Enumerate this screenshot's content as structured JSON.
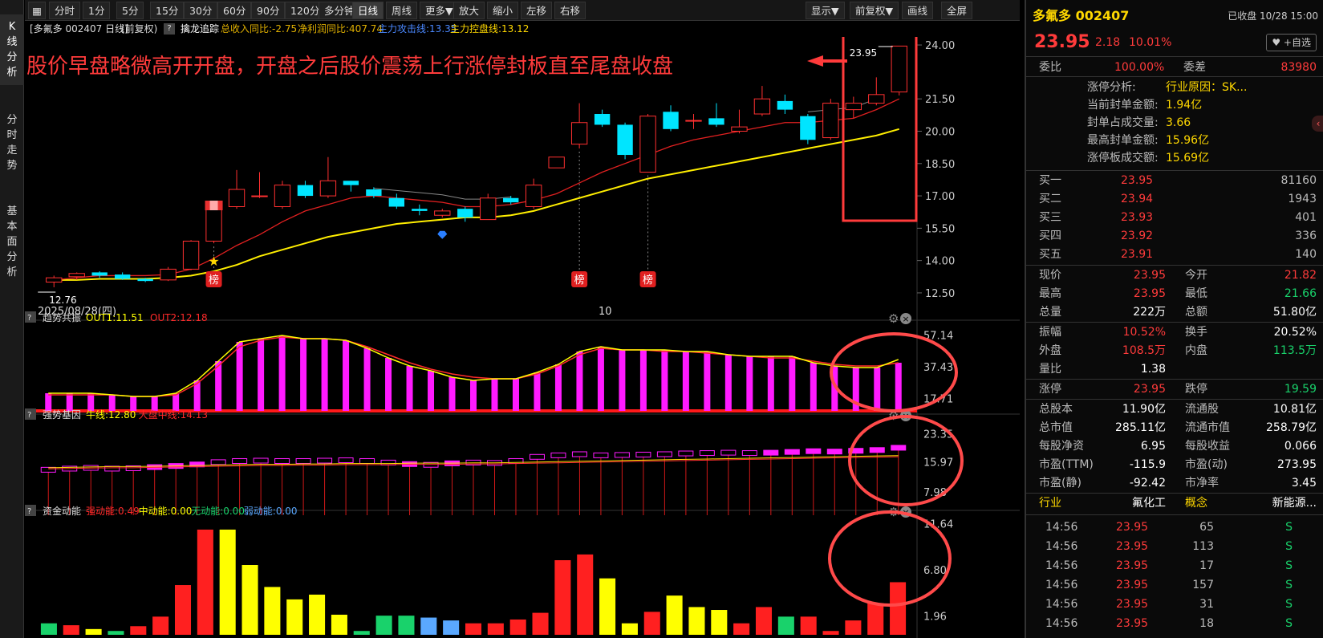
{
  "left_tabs": [
    {
      "label": "K线分析",
      "chars": [
        "K",
        "线",
        "分",
        "析"
      ],
      "active": true
    },
    {
      "label": "分时走势",
      "chars": [
        "分",
        "时",
        "走",
        "势"
      ],
      "active": false
    },
    {
      "label": "基本面分析",
      "chars": [
        "基",
        "本",
        "面",
        "分",
        "析"
      ],
      "active": false
    }
  ],
  "toolbar": {
    "grid_icon": "grid-icon",
    "buttons": [
      "分时",
      "1分",
      "5分",
      "15分",
      "30分",
      "60分",
      "90分",
      "120分",
      "多分钟",
      "日线",
      "周线",
      "更多▼",
      "放大",
      "缩小",
      "左移",
      "右移"
    ],
    "active": "日线",
    "right_buttons": [
      "显示▼",
      "前复权▼",
      "画线",
      "全屏"
    ]
  },
  "info_line": {
    "name": "[多氟多 002407 日线]",
    "adjust": "(前复权)",
    "indicator": "擒龙追踪",
    "revenue": "总收入同比:-2.75",
    "profit": "净利润同比:407.74",
    "attack": "主力攻击线:13.35",
    "control": "主力控盘线:13.12"
  },
  "annotation": {
    "text": "股价早盘略微高开开盘，开盘之后股价震荡上行涨停封板直至尾盘收盘",
    "color": "#ff3b3b"
  },
  "main_chart": {
    "y_ticks": [
      "24.00",
      "21.50",
      "20.00",
      "18.50",
      "17.00",
      "15.50",
      "14.00",
      "12.50"
    ],
    "low_label": "12.76",
    "high_label": "23.95",
    "date_label": "2025/08/28(四)",
    "mid_date": "10",
    "badge": "榜"
  },
  "chart_data": [
    {
      "type": "candlestick",
      "title": "日线",
      "y_range": [
        12.2,
        24.3
      ],
      "y_ticks": [
        24.0,
        21.5,
        20.0,
        18.5,
        17.0,
        15.5,
        14.0,
        12.5
      ],
      "candles": [
        {
          "o": 13.0,
          "c": 13.2,
          "h": 13.3,
          "l": 12.76
        },
        {
          "o": 13.25,
          "c": 13.4,
          "h": 13.45,
          "l": 13.1
        },
        {
          "o": 13.45,
          "c": 13.3,
          "h": 13.5,
          "l": 13.2
        },
        {
          "o": 13.35,
          "c": 13.15,
          "h": 13.45,
          "l": 13.1
        },
        {
          "o": 13.15,
          "c": 13.05,
          "h": 13.2,
          "l": 13.0
        },
        {
          "o": 13.1,
          "c": 13.6,
          "h": 13.7,
          "l": 13.05
        },
        {
          "o": 13.6,
          "c": 14.9,
          "h": 14.95,
          "l": 13.55
        },
        {
          "o": 14.9,
          "c": 16.4,
          "h": 16.45,
          "l": 14.8
        },
        {
          "o": 16.5,
          "c": 17.3,
          "h": 18.2,
          "l": 16.4
        },
        {
          "o": 17.0,
          "c": 17.0,
          "h": 18.1,
          "l": 16.9
        },
        {
          "o": 16.5,
          "c": 17.5,
          "h": 17.7,
          "l": 16.4
        },
        {
          "o": 17.5,
          "c": 17.0,
          "h": 17.7,
          "l": 16.9
        },
        {
          "o": 17.0,
          "c": 17.7,
          "h": 18.8,
          "l": 16.9
        },
        {
          "o": 17.7,
          "c": 17.5,
          "h": 17.7,
          "l": 17.2
        },
        {
          "o": 17.3,
          "c": 17.0,
          "h": 17.4,
          "l": 16.9
        },
        {
          "o": 16.9,
          "c": 16.5,
          "h": 17.1,
          "l": 16.4
        },
        {
          "o": 16.4,
          "c": 16.3,
          "h": 16.6,
          "l": 16.1
        },
        {
          "o": 16.1,
          "c": 16.3,
          "h": 16.4,
          "l": 16.0
        },
        {
          "o": 16.4,
          "c": 16.0,
          "h": 16.5,
          "l": 15.8
        },
        {
          "o": 15.9,
          "c": 16.9,
          "h": 17.1,
          "l": 15.9
        },
        {
          "o": 16.9,
          "c": 16.7,
          "h": 17.0,
          "l": 16.6
        },
        {
          "o": 16.5,
          "c": 17.5,
          "h": 17.8,
          "l": 16.4
        },
        {
          "o": 18.3,
          "c": 18.8,
          "h": 18.8,
          "l": 18.3
        },
        {
          "o": 19.4,
          "c": 20.4,
          "h": 21.3,
          "l": 19.2
        },
        {
          "o": 20.8,
          "c": 20.3,
          "h": 21.0,
          "l": 20.2
        },
        {
          "o": 20.3,
          "c": 18.9,
          "h": 20.4,
          "l": 18.7
        },
        {
          "o": 18.1,
          "c": 20.7,
          "h": 20.8,
          "l": 18.1
        },
        {
          "o": 20.9,
          "c": 20.1,
          "h": 21.2,
          "l": 20.0
        },
        {
          "o": 20.5,
          "c": 20.5,
          "h": 20.8,
          "l": 20.1
        },
        {
          "o": 20.6,
          "c": 20.3,
          "h": 21.3,
          "l": 20.2
        },
        {
          "o": 20.0,
          "c": 20.2,
          "h": 21.0,
          "l": 19.9
        },
        {
          "o": 20.8,
          "c": 21.5,
          "h": 22.1,
          "l": 20.7
        },
        {
          "o": 21.4,
          "c": 21.0,
          "h": 21.7,
          "l": 20.8
        },
        {
          "o": 20.7,
          "c": 19.6,
          "h": 20.8,
          "l": 19.4
        },
        {
          "o": 19.7,
          "c": 21.3,
          "h": 21.5,
          "l": 19.6
        },
        {
          "o": 21.0,
          "c": 21.3,
          "h": 21.6,
          "l": 20.6
        },
        {
          "o": 21.3,
          "c": 21.7,
          "h": 22.5,
          "l": 21.2
        },
        {
          "o": 21.82,
          "c": 23.95,
          "h": 23.95,
          "l": 21.66
        }
      ],
      "ma_red": [
        13.1,
        13.2,
        13.3,
        13.3,
        13.3,
        13.35,
        13.6,
        14.1,
        14.7,
        15.2,
        15.8,
        16.3,
        16.6,
        16.9,
        17.0,
        16.9,
        16.8,
        16.7,
        16.5,
        16.5,
        16.6,
        16.8,
        17.1,
        17.6,
        18.1,
        18.5,
        18.9,
        19.3,
        19.6,
        19.8,
        20.0,
        20.2,
        20.4,
        20.4,
        20.5,
        20.6,
        21.0,
        21.5
      ],
      "ma_yellow": [
        13.1,
        13.1,
        13.15,
        13.15,
        13.15,
        13.2,
        13.3,
        13.5,
        13.8,
        14.2,
        14.5,
        14.8,
        15.1,
        15.3,
        15.5,
        15.7,
        15.8,
        15.9,
        16.0,
        16.0,
        16.1,
        16.3,
        16.6,
        16.9,
        17.2,
        17.5,
        17.8,
        18.0,
        18.2,
        18.4,
        18.6,
        18.8,
        19.0,
        19.2,
        19.4,
        19.6,
        19.8,
        20.1
      ],
      "ma_gray_note": "gray connector line between candles 14-20",
      "badges_at": [
        7,
        23,
        26
      ],
      "star_at": 7,
      "diamond_at": 17
    },
    {
      "type": "bar",
      "title": "趋势共振",
      "y_range": [
        10,
        62
      ],
      "y_ticks": [
        57.14,
        37.43,
        17.71
      ],
      "values": [
        21,
        21,
        21,
        20,
        19,
        19,
        21,
        29,
        41,
        53,
        55,
        57,
        55,
        55,
        54,
        49,
        43,
        38,
        35,
        31,
        29,
        30,
        30,
        34,
        39,
        47,
        50,
        48,
        48,
        48,
        47,
        47,
        45,
        44,
        44,
        44,
        40,
        38,
        37,
        37,
        40
      ],
      "out1_line": [
        21,
        21,
        21,
        20,
        19,
        19,
        21,
        29,
        41,
        53,
        55,
        57,
        55,
        55,
        54,
        49,
        43,
        38,
        35,
        31,
        29,
        30,
        30,
        34,
        39,
        47,
        50,
        48,
        48,
        48,
        47,
        47,
        45,
        44,
        44,
        44,
        40,
        38,
        37,
        37,
        42
      ],
      "out2_line": [
        20,
        20,
        20,
        20,
        19,
        19,
        20,
        27,
        38,
        50,
        54,
        56,
        55,
        55,
        54,
        50,
        45,
        40,
        36,
        33,
        31,
        30,
        30,
        33,
        38,
        45,
        49,
        48,
        48,
        47,
        47,
        46,
        45,
        44,
        43,
        43,
        41,
        39,
        38,
        38,
        40
      ],
      "legend": [
        "OUT1:11.51",
        "OUT2:12.18"
      ]
    },
    {
      "type": "bar",
      "title": "强势基因",
      "y_range": [
        4,
        26
      ],
      "y_ticks": [
        23.35,
        15.97,
        7.98
      ],
      "values": [
        14.5,
        14.8,
        15.0,
        14.8,
        14.9,
        15.2,
        15.5,
        15.9,
        16.5,
        16.8,
        16.9,
        16.8,
        16.8,
        16.9,
        17.0,
        16.8,
        16.4,
        16.0,
        15.8,
        16.2,
        16.4,
        16.3,
        16.8,
        17.9,
        18.3,
        18.6,
        18.3,
        18.4,
        18.5,
        18.6,
        18.8,
        18.9,
        19.0,
        18.9,
        19.0,
        19.2,
        19.4,
        19.3,
        19.5,
        19.7,
        20.3
      ],
      "yellow_line": [
        14.4,
        14.5,
        14.6,
        14.7,
        14.7,
        14.8,
        14.9,
        15.0,
        15.1,
        15.2,
        15.3,
        15.3,
        15.4,
        15.4,
        15.5,
        15.5,
        15.5,
        15.6,
        15.6,
        15.6,
        15.7,
        15.7,
        15.8,
        15.9,
        16.0,
        16.1,
        16.2,
        16.3,
        16.4,
        16.5,
        16.6,
        16.7,
        16.8,
        16.9,
        17.0,
        17.1,
        17.2,
        17.3,
        17.4,
        17.5,
        17.6
      ],
      "legend": [
        "牛线:12.80",
        "大盘中线:14.13"
      ]
    },
    {
      "type": "bar",
      "title": "资金动能",
      "y_range": [
        0,
        12
      ],
      "y_ticks": [
        11.64,
        6.8,
        1.96
      ],
      "values": [
        1.2,
        1.0,
        0.6,
        0.4,
        0.9,
        1.9,
        5.2,
        11.0,
        11.0,
        7.3,
        5.0,
        3.7,
        4.2,
        2.1,
        0.4,
        2.0,
        2.0,
        1.8,
        1.5,
        1.2,
        1.2,
        1.6,
        2.3,
        7.8,
        8.4,
        5.9,
        1.2,
        2.4,
        4.1,
        2.9,
        2.6,
        1.2,
        2.9,
        1.9,
        1.9,
        0.4,
        1.5,
        3.3,
        5.5
      ],
      "colors": [
        "#19d26b",
        "#ff2020",
        "#ffff00",
        "#19d26b",
        "#ff2020",
        "#ff2020",
        "#ff2020",
        "#ff2020",
        "#ffff00",
        "#ffff00",
        "#ffff00",
        "#ffff00",
        "#ffff00",
        "#ffff00",
        "#19d26b",
        "#19d26b",
        "#19d26b",
        "#5aa8ff",
        "#5aa8ff",
        "#ff2020",
        "#ff2020",
        "#ff2020",
        "#ff2020",
        "#ff2020",
        "#ff2020",
        "#ffff00",
        "#ffff00",
        "#ff2020",
        "#ffff00",
        "#ffff00",
        "#ffff00",
        "#ff2020",
        "#ff2020",
        "#19d26b",
        "#ff2020",
        "#ff2020",
        "#ff2020",
        "#ff2020",
        "#ff2020"
      ],
      "legend": [
        "强动能:0.49",
        "中动能:0.00",
        "无动能:0.00",
        "弱动能:0.00"
      ]
    }
  ],
  "right_panel": {
    "title": "多氟多 002407",
    "datetime": "已收盘 10/28 15:00",
    "price": "23.95",
    "change": "2.18",
    "pct": "10.01%",
    "add_watch": "♥ +自选",
    "weibi_label": "委比",
    "weibi": "100.00%",
    "weicha_label": "委差",
    "weicha": "83980",
    "limit_lines": [
      {
        "label": "涨停分析:",
        "value": "行业原因：SK..."
      },
      {
        "label": "当前封单金额:",
        "value": "1.94亿"
      },
      {
        "label": "封单占成交量:",
        "value": "3.66"
      },
      {
        "label": "最高封单金额:",
        "value": "15.96亿"
      },
      {
        "label": "涨停板成交额:",
        "value": "15.69亿"
      }
    ],
    "bids": [
      {
        "label": "买一",
        "price": "23.95",
        "vol": "81160"
      },
      {
        "label": "买二",
        "price": "23.94",
        "vol": "1943"
      },
      {
        "label": "买三",
        "price": "23.93",
        "vol": "401"
      },
      {
        "label": "买四",
        "price": "23.92",
        "vol": "336"
      },
      {
        "label": "买五",
        "price": "23.91",
        "vol": "140"
      }
    ],
    "stats": [
      [
        {
          "l": "现价",
          "v": "23.95",
          "c": "red"
        },
        {
          "l": "今开",
          "v": "21.82",
          "c": "red"
        }
      ],
      [
        {
          "l": "最高",
          "v": "23.95",
          "c": "red"
        },
        {
          "l": "最低",
          "v": "21.66",
          "c": "green"
        }
      ],
      [
        {
          "l": "总量",
          "v": "222万",
          "c": "white"
        },
        {
          "l": "总额",
          "v": "51.80亿",
          "c": "white"
        }
      ],
      [
        {
          "l": "振幅",
          "v": "10.52%",
          "c": "red"
        },
        {
          "l": "换手",
          "v": "20.52%",
          "c": "white"
        }
      ],
      [
        {
          "l": "外盘",
          "v": "108.5万",
          "c": "red"
        },
        {
          "l": "内盘",
          "v": "113.5万",
          "c": "green"
        }
      ],
      [
        {
          "l": "量比",
          "v": "1.38",
          "c": "white"
        },
        {
          "l": "",
          "v": "",
          "c": "white"
        }
      ],
      [
        {
          "l": "涨停",
          "v": "23.95",
          "c": "red"
        },
        {
          "l": "跌停",
          "v": "19.59",
          "c": "green"
        }
      ],
      [
        {
          "l": "总股本",
          "v": "11.90亿",
          "c": "white"
        },
        {
          "l": "流通股",
          "v": "10.81亿",
          "c": "white"
        }
      ],
      [
        {
          "l": "总市值",
          "v": "285.11亿",
          "c": "white"
        },
        {
          "l": "流通市值",
          "v": "258.79亿",
          "c": "white"
        }
      ],
      [
        {
          "l": "每股净资",
          "v": "6.95",
          "c": "white"
        },
        {
          "l": "每股收益",
          "v": "0.066",
          "c": "white"
        }
      ],
      [
        {
          "l": "市盈(TTM)",
          "v": "-115.9",
          "c": "white"
        },
        {
          "l": "市盈(动)",
          "v": "273.95",
          "c": "white"
        }
      ],
      [
        {
          "l": "市盈(静)",
          "v": "-92.42",
          "c": "white"
        },
        {
          "l": "市净率",
          "v": "3.45",
          "c": "white"
        }
      ]
    ],
    "industry": {
      "label": "行业",
      "value": "氟化工",
      "concept_label": "概念",
      "concept": "新能源..."
    },
    "ticks": [
      {
        "t": "14:56",
        "p": "23.95",
        "v": "65",
        "s": "S"
      },
      {
        "t": "14:56",
        "p": "23.95",
        "v": "113",
        "s": "S"
      },
      {
        "t": "14:56",
        "p": "23.95",
        "v": "17",
        "s": "S"
      },
      {
        "t": "14:56",
        "p": "23.95",
        "v": "157",
        "s": "S"
      },
      {
        "t": "14:56",
        "p": "23.95",
        "v": "31",
        "s": "S"
      },
      {
        "t": "14:56",
        "p": "23.95",
        "v": "18",
        "s": "S"
      }
    ]
  }
}
